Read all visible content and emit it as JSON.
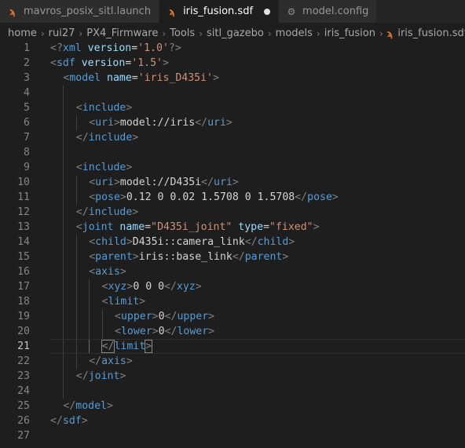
{
  "tabs": [
    {
      "label": "mavros_posix_sitl.launch",
      "icon": "rss-icon",
      "active": false,
      "modified": false
    },
    {
      "label": "iris_fusion.sdf",
      "icon": "rss-icon",
      "active": true,
      "modified": true
    },
    {
      "label": "model.config",
      "icon": "gear-icon",
      "active": false,
      "modified": false
    }
  ],
  "breadcrumb": [
    "home",
    "rui27",
    "PX4_Firmware",
    "Tools",
    "sitl_gazebo",
    "models",
    "iris_fusion",
    "iris_fusion.sdf"
  ],
  "editor": {
    "current_line": 21,
    "lines": [
      {
        "n": "1",
        "indent": 0,
        "tokens": [
          [
            "prolog",
            "<?"
          ],
          [
            "prologname",
            "xml"
          ],
          [
            "text",
            " "
          ],
          [
            "attr",
            "version"
          ],
          [
            "text",
            "="
          ],
          [
            "str",
            "'1.0'"
          ],
          [
            "prolog",
            "?>"
          ]
        ]
      },
      {
        "n": "2",
        "indent": 0,
        "tokens": [
          [
            "bracket",
            "<"
          ],
          [
            "tag",
            "sdf"
          ],
          [
            "text",
            " "
          ],
          [
            "attr",
            "version"
          ],
          [
            "text",
            "="
          ],
          [
            "str",
            "'1.5'"
          ],
          [
            "bracket",
            ">"
          ]
        ]
      },
      {
        "n": "3",
        "indent": 1,
        "tokens": [
          [
            "bracket",
            "<"
          ],
          [
            "tag",
            "model"
          ],
          [
            "text",
            " "
          ],
          [
            "attr",
            "name"
          ],
          [
            "text",
            "="
          ],
          [
            "str",
            "'iris_D435i'"
          ],
          [
            "bracket",
            ">"
          ]
        ]
      },
      {
        "n": "4",
        "indent": 2,
        "tokens": []
      },
      {
        "n": "5",
        "indent": 2,
        "tokens": [
          [
            "bracket",
            "<"
          ],
          [
            "tag",
            "include"
          ],
          [
            "bracket",
            ">"
          ]
        ]
      },
      {
        "n": "6",
        "indent": 3,
        "tokens": [
          [
            "bracket",
            "<"
          ],
          [
            "tag",
            "uri"
          ],
          [
            "bracket",
            ">"
          ],
          [
            "text",
            "model://iris"
          ],
          [
            "bracket",
            "</"
          ],
          [
            "tag",
            "uri"
          ],
          [
            "bracket",
            ">"
          ]
        ]
      },
      {
        "n": "7",
        "indent": 2,
        "tokens": [
          [
            "bracket",
            "</"
          ],
          [
            "tag",
            "include"
          ],
          [
            "bracket",
            ">"
          ]
        ]
      },
      {
        "n": "8",
        "indent": 2,
        "tokens": []
      },
      {
        "n": "9",
        "indent": 2,
        "tokens": [
          [
            "bracket",
            "<"
          ],
          [
            "tag",
            "include"
          ],
          [
            "bracket",
            ">"
          ]
        ]
      },
      {
        "n": "10",
        "indent": 3,
        "tokens": [
          [
            "bracket",
            "<"
          ],
          [
            "tag",
            "uri"
          ],
          [
            "bracket",
            ">"
          ],
          [
            "text",
            "model://D435i"
          ],
          [
            "bracket",
            "</"
          ],
          [
            "tag",
            "uri"
          ],
          [
            "bracket",
            ">"
          ]
        ]
      },
      {
        "n": "11",
        "indent": 3,
        "tokens": [
          [
            "bracket",
            "<"
          ],
          [
            "tag",
            "pose"
          ],
          [
            "bracket",
            ">"
          ],
          [
            "text",
            "0.12 0 0.02 1.5708 0 1.5708"
          ],
          [
            "bracket",
            "</"
          ],
          [
            "tag",
            "pose"
          ],
          [
            "bracket",
            ">"
          ]
        ]
      },
      {
        "n": "12",
        "indent": 2,
        "tokens": [
          [
            "bracket",
            "</"
          ],
          [
            "tag",
            "include"
          ],
          [
            "bracket",
            ">"
          ]
        ]
      },
      {
        "n": "13",
        "indent": 2,
        "tokens": [
          [
            "bracket",
            "<"
          ],
          [
            "tag",
            "joint"
          ],
          [
            "text",
            " "
          ],
          [
            "attr",
            "name"
          ],
          [
            "text",
            "="
          ],
          [
            "str",
            "\"D435i_joint\""
          ],
          [
            "text",
            " "
          ],
          [
            "attr",
            "type"
          ],
          [
            "text",
            "="
          ],
          [
            "str",
            "\"fixed\""
          ],
          [
            "bracket",
            ">"
          ]
        ]
      },
      {
        "n": "14",
        "indent": 3,
        "tokens": [
          [
            "bracket",
            "<"
          ],
          [
            "tag",
            "child"
          ],
          [
            "bracket",
            ">"
          ],
          [
            "text",
            "D435i::camera_link"
          ],
          [
            "bracket",
            "</"
          ],
          [
            "tag",
            "child"
          ],
          [
            "bracket",
            ">"
          ]
        ]
      },
      {
        "n": "15",
        "indent": 3,
        "tokens": [
          [
            "bracket",
            "<"
          ],
          [
            "tag",
            "parent"
          ],
          [
            "bracket",
            ">"
          ],
          [
            "text",
            "iris::base_link"
          ],
          [
            "bracket",
            "</"
          ],
          [
            "tag",
            "parent"
          ],
          [
            "bracket",
            ">"
          ]
        ]
      },
      {
        "n": "16",
        "indent": 3,
        "tokens": [
          [
            "bracket",
            "<"
          ],
          [
            "tag",
            "axis"
          ],
          [
            "bracket",
            ">"
          ]
        ]
      },
      {
        "n": "17",
        "indent": 4,
        "tokens": [
          [
            "bracket",
            "<"
          ],
          [
            "tag",
            "xyz"
          ],
          [
            "bracket",
            ">"
          ],
          [
            "text",
            "0 0 0"
          ],
          [
            "bracket",
            "</"
          ],
          [
            "tag",
            "xyz"
          ],
          [
            "bracket",
            ">"
          ]
        ]
      },
      {
        "n": "18",
        "indent": 4,
        "tokens": [
          [
            "bracket",
            "<"
          ],
          [
            "tag",
            "limit"
          ],
          [
            "bracket",
            ">"
          ]
        ]
      },
      {
        "n": "19",
        "indent": 5,
        "tokens": [
          [
            "bracket",
            "<"
          ],
          [
            "tag",
            "upper"
          ],
          [
            "bracket",
            ">"
          ],
          [
            "text",
            "0"
          ],
          [
            "bracket",
            "</"
          ],
          [
            "tag",
            "upper"
          ],
          [
            "bracket",
            ">"
          ]
        ]
      },
      {
        "n": "20",
        "indent": 5,
        "tokens": [
          [
            "bracket",
            "<"
          ],
          [
            "tag",
            "lower"
          ],
          [
            "bracket",
            ">"
          ],
          [
            "text",
            "0"
          ],
          [
            "bracket",
            "</"
          ],
          [
            "tag",
            "lower"
          ],
          [
            "bracket",
            ">"
          ]
        ]
      },
      {
        "n": "21",
        "indent": 4,
        "tokens": [
          [
            "bracket",
            "</"
          ],
          [
            "tag",
            "limit"
          ],
          [
            "bracket",
            ">"
          ]
        ]
      },
      {
        "n": "22",
        "indent": 3,
        "tokens": [
          [
            "bracket",
            "</"
          ],
          [
            "tag",
            "axis"
          ],
          [
            "bracket",
            ">"
          ]
        ]
      },
      {
        "n": "23",
        "indent": 2,
        "tokens": [
          [
            "bracket",
            "</"
          ],
          [
            "tag",
            "joint"
          ],
          [
            "bracket",
            ">"
          ]
        ]
      },
      {
        "n": "24",
        "indent": 2,
        "tokens": []
      },
      {
        "n": "25",
        "indent": 1,
        "tokens": [
          [
            "bracket",
            "</"
          ],
          [
            "tag",
            "model"
          ],
          [
            "bracket",
            ">"
          ]
        ]
      },
      {
        "n": "26",
        "indent": 0,
        "tokens": [
          [
            "bracket",
            "</"
          ],
          [
            "tag",
            "sdf"
          ],
          [
            "bracket",
            ">"
          ]
        ]
      },
      {
        "n": "27",
        "indent": 0,
        "tokens": []
      }
    ]
  }
}
